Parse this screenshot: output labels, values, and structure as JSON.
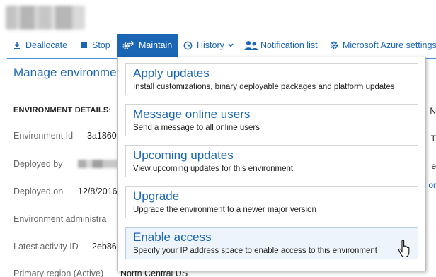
{
  "toolbar": {
    "items": [
      {
        "label": "Deallocate",
        "icon": "deallocate-icon"
      },
      {
        "label": "Stop",
        "icon": "stop-icon"
      },
      {
        "label": "Maintain",
        "icon": "gears-icon",
        "active": true
      },
      {
        "label": "History",
        "icon": "clock-icon"
      },
      {
        "label": "Notification list",
        "icon": "users-icon"
      },
      {
        "label": "Microsoft Azure settings",
        "icon": "gear-icon"
      }
    ]
  },
  "panel": {
    "title": "Manage environme",
    "section_heading": "ENVIRONMENT DETAILS:",
    "fields": [
      {
        "label": "Environment Id",
        "value": "3a1860"
      },
      {
        "label": "Deployed by",
        "value": ""
      },
      {
        "label": "Deployed on",
        "value": "12/8/2016"
      },
      {
        "label": "Environment administra",
        "value": ""
      },
      {
        "label": "Latest activity ID",
        "value": "2eb86"
      },
      {
        "label": "Primary region (Active)",
        "value": "North Central US"
      }
    ],
    "right_fragments": {
      "n": "N",
      "t": "T",
      "e": "e",
      "link": "or"
    }
  },
  "menu": {
    "items": [
      {
        "title": "Apply updates",
        "description": "Install customizations, binary deployable packages and platform updates"
      },
      {
        "title": "Message online users",
        "description": "Send a message to all online users"
      },
      {
        "title": "Upcoming updates",
        "description": "View upcoming updates for this environment"
      },
      {
        "title": "Upgrade",
        "description": "Upgrade the environment to a newer major version"
      },
      {
        "title": "Enable access",
        "description": "Specify your IP address space to enable access to this environment",
        "hovered": true
      }
    ]
  },
  "colors": {
    "accent": "#1a66b5",
    "hover_bg": "#eef4fb",
    "rule": "#4a90d9"
  }
}
